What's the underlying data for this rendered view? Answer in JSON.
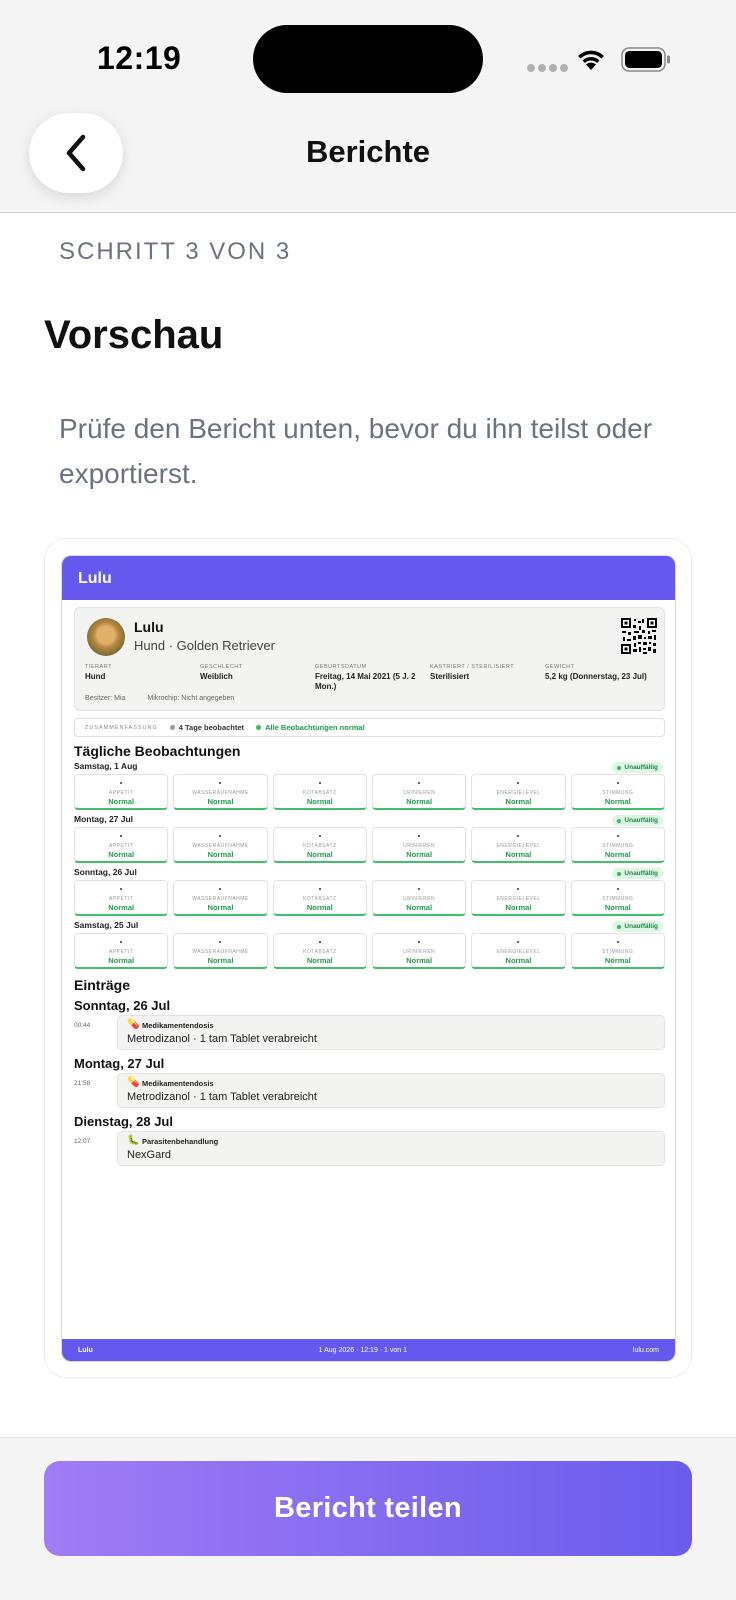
{
  "status_bar": {
    "time": "12:19"
  },
  "nav": {
    "title": "Berichte"
  },
  "step": "SCHRITT 3 VON 3",
  "heading": "Vorschau",
  "description": "Prüfe den Bericht unten, bevor du ihn teilst oder exportierst.",
  "report": {
    "header_title": "Lulu",
    "pet": {
      "name": "Lulu",
      "subtitle": "Hund · Golden Retriever",
      "fields": [
        {
          "label": "TIERART",
          "value": "Hund"
        },
        {
          "label": "GESCHLECHT",
          "value": "Weiblich"
        },
        {
          "label": "GEBURTSDATUM",
          "value": "Freitag, 14 Mai 2021 (5 J. 2 Mon.)"
        },
        {
          "label": "KASTRIERT / STERILISIERT",
          "value": "Sterilisiert"
        },
        {
          "label": "GEWICHT",
          "value": "5,2 kg (Donnerstag, 23 Jul)"
        }
      ],
      "owner": "Besitzer: Mia",
      "microchip": "Mikrochip: Nicht angegeben"
    },
    "summary": {
      "label": "ZUSAMMENFASSUNG",
      "observed": "4 Tage beobachtet",
      "all_normal": "Alle Beobachtungen normal"
    },
    "daily_title": "Tägliche Beobachtungen",
    "observation_labels": [
      "APPETIT",
      "WASSERAUFNAHME",
      "KOTABSATZ",
      "URINIEREN",
      "ENERGIELEVEL",
      "STIMMUNG"
    ],
    "days": [
      {
        "date": "Samstag, 1 Aug",
        "badge": "Unauffällig",
        "values": [
          "Normal",
          "Normal",
          "Normal",
          "Normal",
          "Normal",
          "Normal"
        ]
      },
      {
        "date": "Montag, 27 Jul",
        "badge": "Unauffällig",
        "values": [
          "Normal",
          "Normal",
          "Normal",
          "Normal",
          "Normal",
          "Normal"
        ]
      },
      {
        "date": "Sonntag, 26 Jul",
        "badge": "Unauffällig",
        "values": [
          "Normal",
          "Normal",
          "Normal",
          "Normal",
          "Normal",
          "Normal"
        ]
      },
      {
        "date": "Samstag, 25 Jul",
        "badge": "Unauffällig",
        "values": [
          "Normal",
          "Normal",
          "Normal",
          "Normal",
          "Normal",
          "Normal"
        ]
      }
    ],
    "entries_title": "Einträge",
    "entries": [
      {
        "day": "Sonntag, 26 Jul",
        "time": "00:44",
        "icon": "pill-icon",
        "type": "Medikamentendosis",
        "text": "Metrodizanol · 1 tam Tablet verabreicht"
      },
      {
        "day": "Montag, 27 Jul",
        "time": "21:58",
        "icon": "pill-icon",
        "type": "Medikamentendosis",
        "text": "Metrodizanol · 1 tam Tablet verabreicht"
      },
      {
        "day": "Dienstag, 28 Jul",
        "time": "12:07",
        "icon": "bug-icon",
        "type": "Parasitenbehandlung",
        "text": "NexGard"
      }
    ],
    "footer": {
      "left": "Lulu",
      "center": "1 Aug 2026 · 12:19 · 1 von 1",
      "right": "lulu.com"
    }
  },
  "share_button": "Bericht teilen",
  "colors": {
    "accent": "#6558ee",
    "ok_green": "#1e9e4a",
    "button_gradient_start": "#a07cf5",
    "button_gradient_end": "#6a5cec"
  }
}
